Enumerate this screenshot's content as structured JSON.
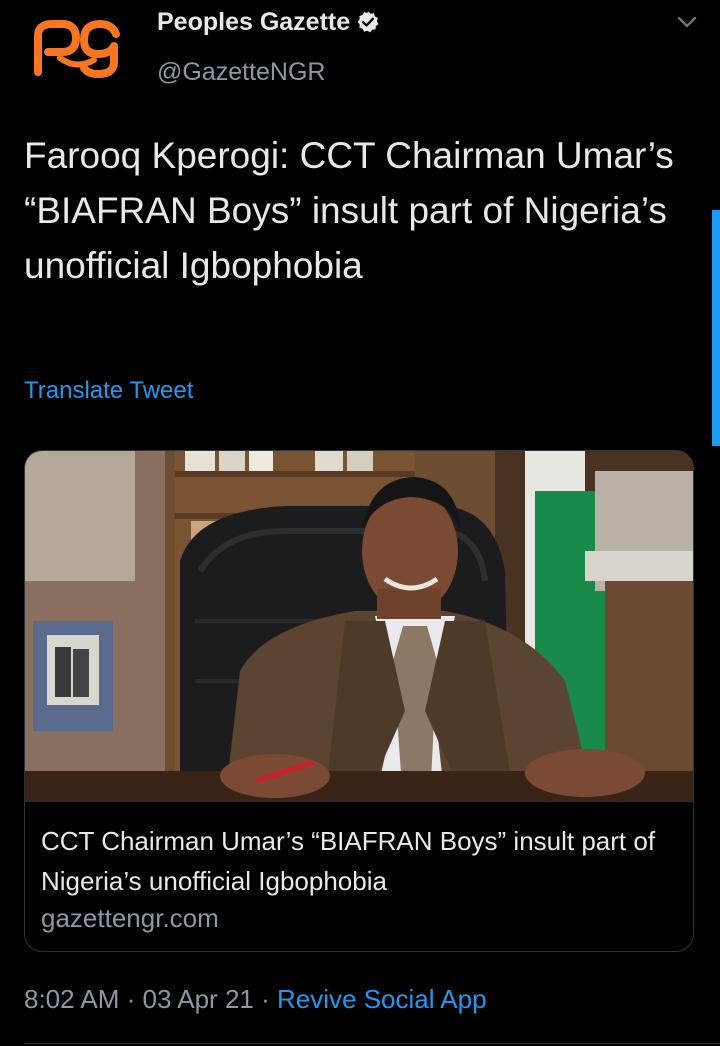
{
  "user": {
    "display_name": "Peoples Gazette",
    "handle": "@GazetteNGR",
    "avatar_icon": "peoples-gazette-logo",
    "verified": true
  },
  "tweet": {
    "text": "Farooq Kperogi: CCT Chairman Umar’s “BIAFRAN Boys” insult part of Nigeria’s unofficial Igbophobia",
    "translate_label": "Translate Tweet"
  },
  "card": {
    "title": "CCT Chairman Umar’s “BIAFRAN Boys” insult part of Nigeria’s unofficial Igbophobia",
    "domain": "gazettengr.com"
  },
  "meta": {
    "time": "8:02 AM",
    "separator": "·",
    "date": "03 Apr 21",
    "source": "Revive Social App"
  },
  "colors": {
    "background": "#000000",
    "text": "#e7e9ea",
    "secondary_text": "#8b98a5",
    "link": "#1d9bf0",
    "logo_orange": "#f7761f"
  }
}
